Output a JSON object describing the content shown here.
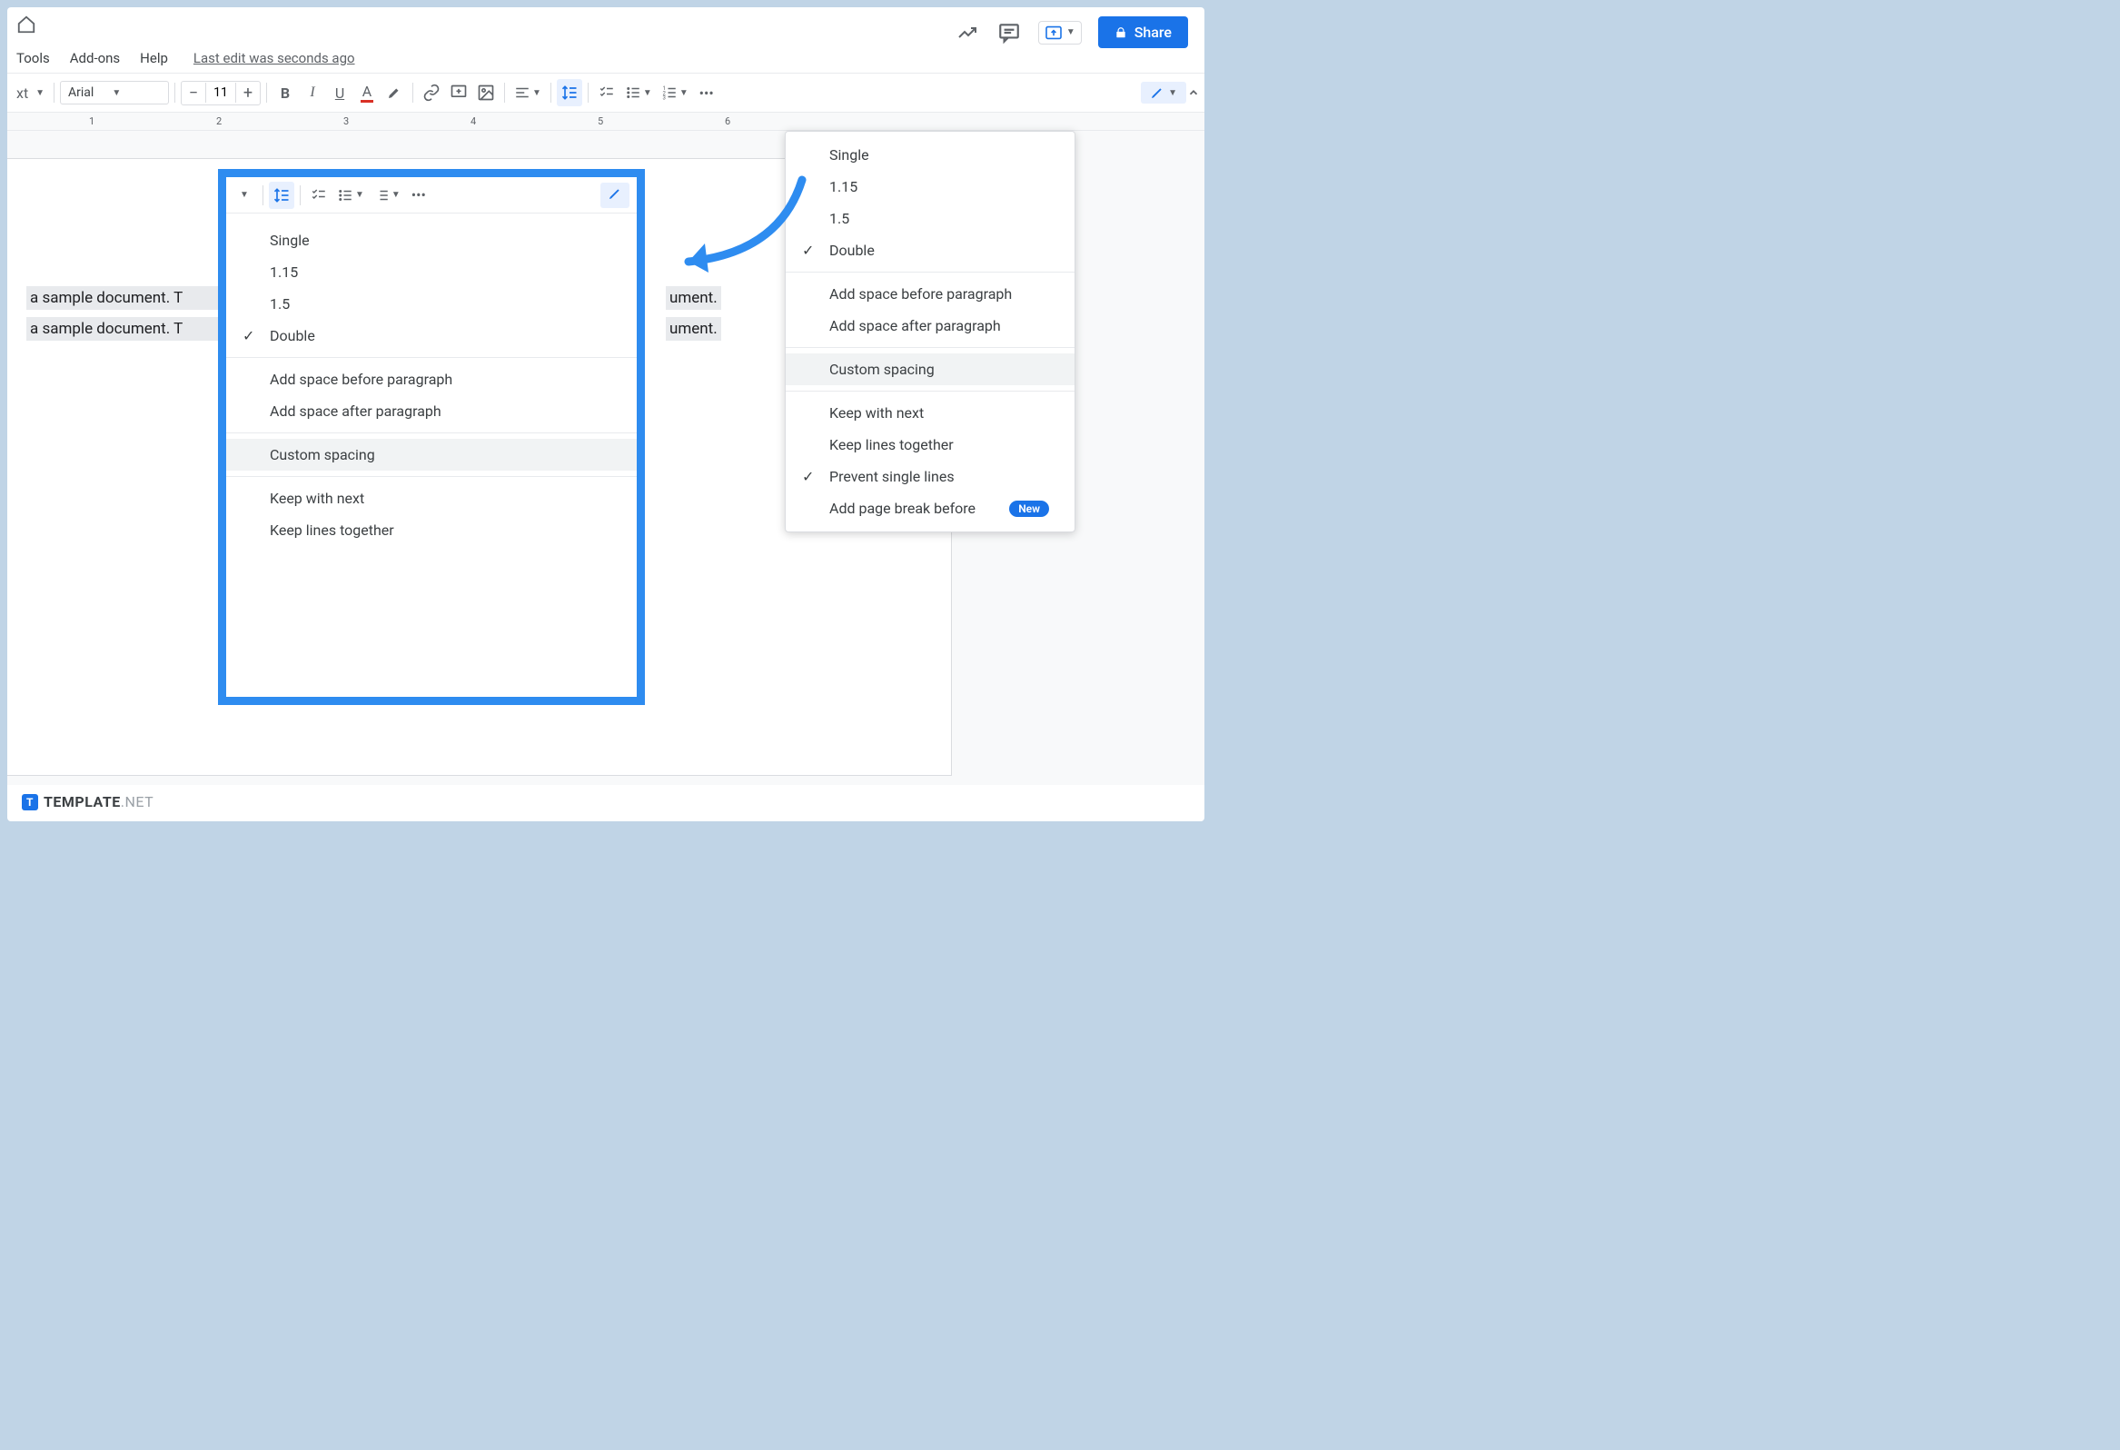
{
  "menus": {
    "tools": "Tools",
    "addons": "Add-ons",
    "help": "Help"
  },
  "last_edit": "Last edit was seconds ago",
  "share_label": "Share",
  "toolbar": {
    "styles_label": "xt",
    "font_name": "Arial",
    "font_size": "11"
  },
  "ruler_ticks": [
    "1",
    "2",
    "3",
    "4",
    "5",
    "6"
  ],
  "doc": {
    "line1_a": "a sample document. T",
    "line1_b": "ument.",
    "line2_a": "a sample document. T",
    "line2_b": "ument."
  },
  "spacing_menu": {
    "single": "Single",
    "v115": "1.15",
    "v15": "1.5",
    "double": "Double",
    "before": "Add space before paragraph",
    "after": "Add space after paragraph",
    "custom": "Custom spacing",
    "keep_next": "Keep with next",
    "keep_lines": "Keep lines together",
    "prevent_single": "Prevent single lines",
    "page_break": "Add page break before",
    "new_badge": "New"
  },
  "watermark": {
    "bold": "TEMPLATE",
    "light": ".NET"
  }
}
